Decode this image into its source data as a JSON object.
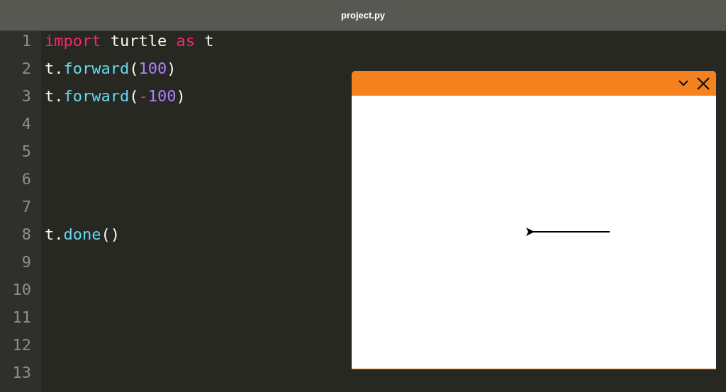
{
  "window": {
    "title": "project.py"
  },
  "editor": {
    "lines": [
      {
        "number": "1",
        "tokens": [
          {
            "kind": "keyword",
            "text": "import"
          },
          {
            "kind": "plain",
            "text": " turtle "
          },
          {
            "kind": "keyword",
            "text": "as"
          },
          {
            "kind": "plain",
            "text": " t"
          }
        ]
      },
      {
        "number": "2",
        "tokens": [
          {
            "kind": "plain",
            "text": "t."
          },
          {
            "kind": "function",
            "text": "forward"
          },
          {
            "kind": "plain",
            "text": "("
          },
          {
            "kind": "number",
            "text": "100"
          },
          {
            "kind": "plain",
            "text": ")"
          }
        ]
      },
      {
        "number": "3",
        "tokens": [
          {
            "kind": "plain",
            "text": "t."
          },
          {
            "kind": "function",
            "text": "forward"
          },
          {
            "kind": "plain",
            "text": "("
          },
          {
            "kind": "keyword",
            "text": "-"
          },
          {
            "kind": "number",
            "text": "100"
          },
          {
            "kind": "plain",
            "text": ")"
          }
        ]
      },
      {
        "number": "4"
      },
      {
        "number": "5"
      },
      {
        "number": "6"
      },
      {
        "number": "7"
      },
      {
        "number": "8",
        "tokens": [
          {
            "kind": "plain",
            "text": "t."
          },
          {
            "kind": "function",
            "text": "done"
          },
          {
            "kind": "plain",
            "text": "()"
          }
        ]
      },
      {
        "number": "9"
      },
      {
        "number": "10"
      },
      {
        "number": "11"
      },
      {
        "number": "12"
      },
      {
        "number": "13"
      }
    ]
  }
}
